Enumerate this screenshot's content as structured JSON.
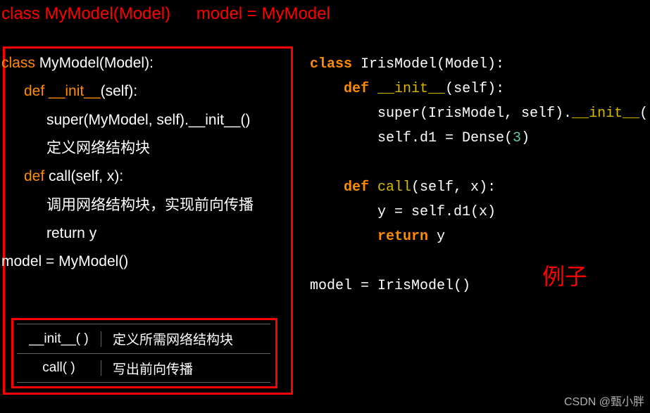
{
  "top_anno": {
    "a": "class MyModel(Model)",
    "b": "model = MyModel"
  },
  "left": {
    "l1_kw": "class",
    "l1_rest": " MyModel(Model):",
    "l2_kw": "def ",
    "l2_fn": "__init__",
    "l2_rest": "(self):",
    "l3": "super(MyModel, self).__init__()",
    "l4": "定义网络结构块",
    "l5_kw": "def",
    "l5_rest": " call(self, x):",
    "l6": "调用网络结构块，实现前向传播",
    "l7": "return y",
    "l8": "model = MyModel()"
  },
  "table": {
    "r1a": "__init__( )",
    "r1b": "定义所需网络结构块",
    "r2a": "call( )",
    "r2b": "写出前向传播"
  },
  "right": {
    "l1_kw": "class",
    "l1_rest": " IrisModel(Model):",
    "l2_kw": "def",
    "l2_sp": " ",
    "l2_fn": "__init__",
    "l2_rest": "(self):",
    "l3a": "super(IrisModel, self).",
    "l3b": "__init__",
    "l3c": "()",
    "l4a": "self.d1 = Dense(",
    "l4n": "3",
    "l4b": ")",
    "l5_kw": "def",
    "l5_fn": " call",
    "l5_rest": "(self, x):",
    "l6": "y = self.d1(x)",
    "l7_kw": "return",
    "l7_rest": " y",
    "l8a": "model = IrisModel()"
  },
  "example_label": "例子",
  "watermark": "CSDN @甄小胖"
}
